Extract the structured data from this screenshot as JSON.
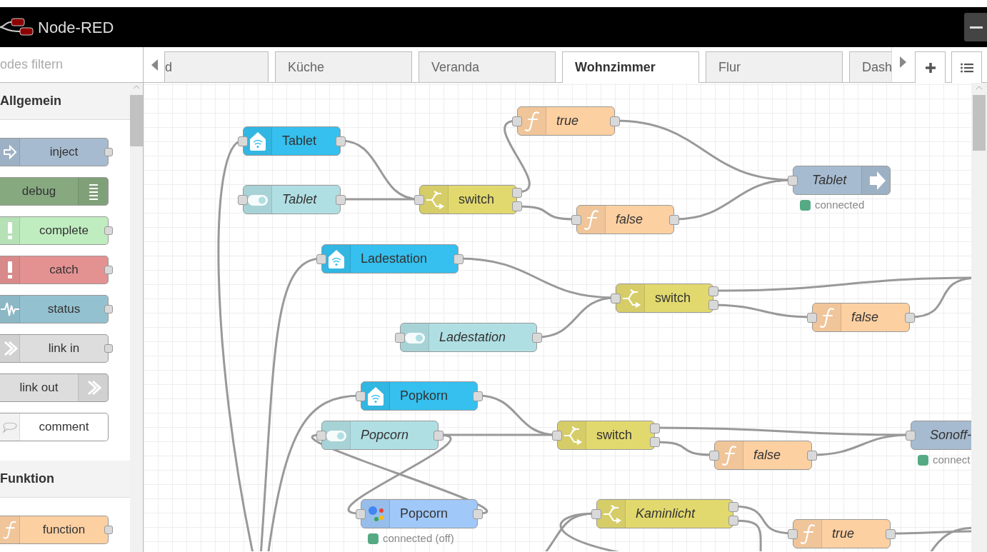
{
  "header": {
    "title": "Node-RED"
  },
  "palette": {
    "filter": {
      "placeholder": "odes filtern"
    },
    "categories": [
      {
        "label": "Allgemein",
        "items": [
          {
            "label": "inject",
            "kind": "inject"
          },
          {
            "label": "debug",
            "kind": "debug"
          },
          {
            "label": "complete",
            "kind": "complete"
          },
          {
            "label": "catch",
            "kind": "catch"
          },
          {
            "label": "status",
            "kind": "status"
          },
          {
            "label": "link in",
            "kind": "link-in"
          },
          {
            "label": "link out",
            "kind": "link-out"
          },
          {
            "label": "comment",
            "kind": "comment"
          }
        ]
      },
      {
        "label": "Funktion",
        "items": [
          {
            "label": "function",
            "kind": "function"
          }
        ]
      }
    ]
  },
  "tabs": [
    {
      "label": "d",
      "selected": false
    },
    {
      "label": "Küche",
      "selected": false
    },
    {
      "label": "Veranda",
      "selected": false
    },
    {
      "label": "Wohnzimmer",
      "selected": true
    },
    {
      "label": "Flur",
      "selected": false
    },
    {
      "label": "Dash",
      "selected": false
    }
  ],
  "nodes": [
    {
      "kind": "ha-device",
      "label": "Tablet",
      "italic": false
    },
    {
      "kind": "function",
      "label": "true",
      "italic": true
    },
    {
      "kind": "toggle",
      "label": "Tablet",
      "italic": true
    },
    {
      "kind": "switch",
      "label": "switch",
      "italic": false
    },
    {
      "kind": "function",
      "label": "false",
      "italic": true
    },
    {
      "kind": "ha-output",
      "label": "Tablet",
      "italic": true,
      "status": "connected"
    },
    {
      "kind": "ha-device",
      "label": "Ladestation",
      "italic": false
    },
    {
      "kind": "toggle",
      "label": "Ladestation",
      "italic": true
    },
    {
      "kind": "switch",
      "label": "switch",
      "italic": false
    },
    {
      "kind": "function",
      "label": "false",
      "italic": true
    },
    {
      "kind": "ha-device",
      "label": "Popkorn",
      "italic": false
    },
    {
      "kind": "toggle",
      "label": "Popcorn",
      "italic": true
    },
    {
      "kind": "switch",
      "label": "switch",
      "italic": false
    },
    {
      "kind": "function",
      "label": "false",
      "italic": true
    },
    {
      "kind": "ha-output",
      "label": "Sonoff-",
      "italic": true,
      "status": "connect"
    },
    {
      "kind": "google",
      "label": "Popcorn",
      "italic": false,
      "status": "connected (off)"
    },
    {
      "kind": "switch",
      "label": "Kaminlicht",
      "italic": true
    },
    {
      "kind": "function",
      "label": "true",
      "italic": true
    }
  ]
}
